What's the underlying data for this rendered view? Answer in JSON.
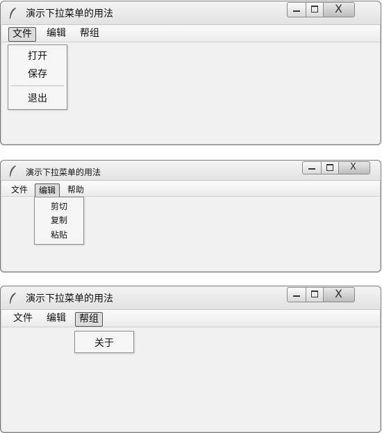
{
  "windows": [
    {
      "title": "演示下拉菜单的用法",
      "menus": [
        "文件",
        "编辑",
        "帮组"
      ],
      "active_menu": "文件",
      "dropdown_items": [
        "打开",
        "保存",
        "退出"
      ]
    },
    {
      "title": "演示下拉菜单的用法",
      "menus": [
        "文件",
        "编辑",
        "帮助"
      ],
      "active_menu": "编辑",
      "dropdown_items": [
        "剪切",
        "复制",
        "粘贴"
      ]
    },
    {
      "title": "演示下拉菜单的用法",
      "menus": [
        "文件",
        "编辑",
        "帮组"
      ],
      "active_menu": "帮组",
      "dropdown_items": [
        "关于"
      ]
    }
  ],
  "close_glyph": "X"
}
